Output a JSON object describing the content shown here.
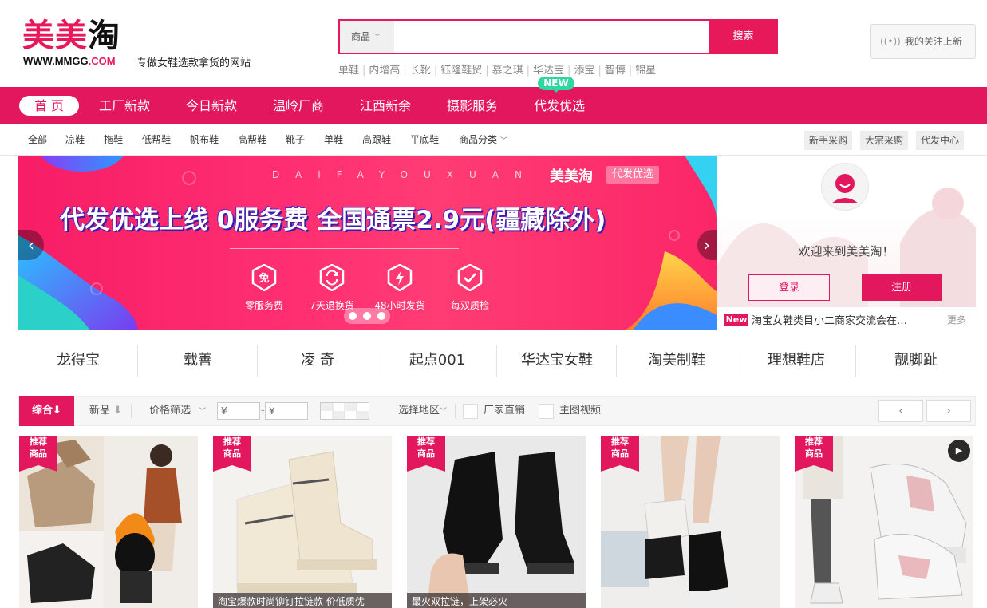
{
  "header": {
    "logo_text_pink": "美美",
    "logo_text_dark": "淘",
    "logo_url_main": "WWW.MMGG",
    "logo_url_com": ".COM",
    "slogan": "专做女鞋选款拿货的网站",
    "search": {
      "category": "商品",
      "placeholder": "",
      "button": "搜索"
    },
    "hot_links": [
      "单鞋",
      "内增高",
      "长靴",
      "钰隆鞋贸",
      "慕之琪",
      "华达宝",
      "添宝",
      "智博",
      "锦星"
    ],
    "follow_label": "我的关注上新"
  },
  "nav": {
    "items": [
      "首 页",
      "工厂新款",
      "今日新款",
      "温岭厂商",
      "江西新余",
      "摄影服务",
      "代发优选"
    ],
    "badge": "NEW"
  },
  "categories": {
    "items": [
      "全部",
      "凉鞋",
      "拖鞋",
      "低帮鞋",
      "帆布鞋",
      "高帮鞋",
      "靴子",
      "单鞋",
      "高跟鞋",
      "平底鞋"
    ],
    "dropdown": "商品分类",
    "buttons": [
      "新手采购",
      "大宗采购",
      "代发中心"
    ]
  },
  "banner": {
    "spell": "DAIFAYOUXUAN",
    "brand": "美美淘",
    "tag": "代发优选",
    "headline": "代发优选上线 0服务费 全国通票2.9元(疆藏除外)",
    "features": [
      {
        "label": "零服务费",
        "icon": "free-icon"
      },
      {
        "label": "7天退换货",
        "icon": "exchange-icon"
      },
      {
        "label": "48小时发货",
        "icon": "lightning-icon"
      },
      {
        "label": "每双质检",
        "icon": "check-icon"
      }
    ],
    "free_char": "免"
  },
  "sidebar": {
    "welcome": "欢迎来到美美淘！",
    "login": "登录",
    "register": "注册",
    "news_badge": "New",
    "news_text": "淘宝女鞋类目小二商家交流会在…",
    "news_more": "更多"
  },
  "brands": [
    "龙得宝",
    "载善",
    "凌 奇",
    "起点001",
    "华达宝女鞋",
    "淘美制鞋",
    "理想鞋店",
    "靓脚趾"
  ],
  "filter": {
    "sort_all": "综合",
    "sort_new": "新品",
    "price_filter": "价格筛选",
    "price_min_prefix": "¥",
    "price_max_prefix": "¥",
    "region": "选择地区",
    "factory_direct": "厂家直销",
    "video": "主图视频",
    "prev": "‹",
    "next": "›"
  },
  "products": [
    {
      "ribbon": "推荐\n商品",
      "caption": ""
    },
    {
      "ribbon": "推荐\n商品",
      "caption": "淘宝爆款时尚铆钉拉链款 价低质优"
    },
    {
      "ribbon": "推荐\n商品",
      "caption": "最火双拉链，上架必火"
    },
    {
      "ribbon": "推荐\n商品",
      "caption": ""
    },
    {
      "ribbon": "推荐\n商品",
      "caption": "",
      "has_video": true
    }
  ],
  "colors": {
    "brand": "#e3175e",
    "accent_green": "#2ed7a1"
  }
}
